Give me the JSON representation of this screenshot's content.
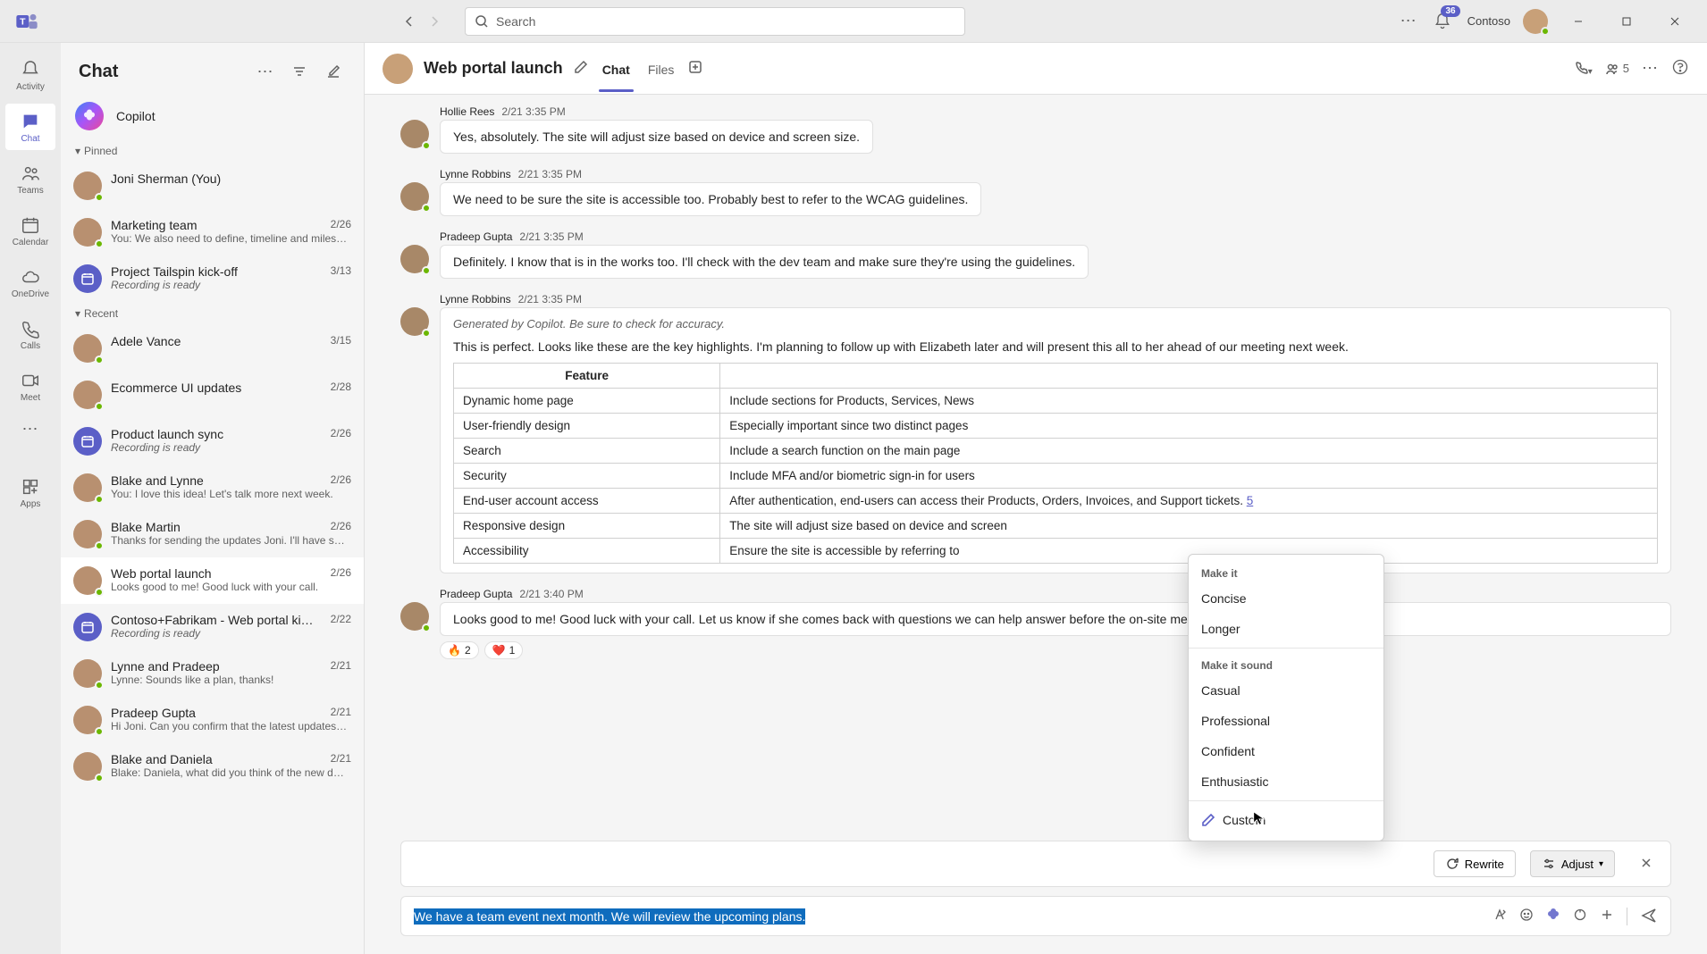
{
  "titlebar": {
    "search_placeholder": "Search",
    "org": "Contoso",
    "notif_count": "36"
  },
  "rail": {
    "items": [
      {
        "id": "activity",
        "label": "Activity"
      },
      {
        "id": "chat",
        "label": "Chat"
      },
      {
        "id": "teams",
        "label": "Teams"
      },
      {
        "id": "calendar",
        "label": "Calendar"
      },
      {
        "id": "onedrive",
        "label": "OneDrive"
      },
      {
        "id": "calls",
        "label": "Calls"
      },
      {
        "id": "meet",
        "label": "Meet"
      }
    ],
    "apps_label": "Apps"
  },
  "chatlist": {
    "title": "Chat",
    "copilot_label": "Copilot",
    "pinned_label": "Pinned",
    "recent_label": "Recent",
    "pinned": [
      {
        "name": "Joni Sherman (You)",
        "date": "",
        "preview": ""
      },
      {
        "name": "Marketing team",
        "date": "2/26",
        "preview": "You: We also need to define, timeline and miles…"
      },
      {
        "name": "Project Tailspin kick-off",
        "date": "3/13",
        "preview": "Recording is ready",
        "italic": true,
        "meeting": true
      }
    ],
    "recent": [
      {
        "name": "Adele Vance",
        "date": "3/15",
        "preview": ""
      },
      {
        "name": "Ecommerce UI updates",
        "date": "2/28",
        "preview": ""
      },
      {
        "name": "Product launch sync",
        "date": "2/26",
        "preview": "Recording is ready",
        "italic": true,
        "meeting": true
      },
      {
        "name": "Blake and Lynne",
        "date": "2/26",
        "preview": "You: I love this idea! Let's talk more next week."
      },
      {
        "name": "Blake Martin",
        "date": "2/26",
        "preview": "Thanks for sending the updates Joni. I'll have s…"
      },
      {
        "name": "Web portal launch",
        "date": "2/26",
        "preview": "Looks good to me! Good luck with your call.",
        "selected": true
      },
      {
        "name": "Contoso+Fabrikam - Web portal ki…",
        "date": "2/22",
        "preview": "Recording is ready",
        "italic": true,
        "meeting": true
      },
      {
        "name": "Lynne and Pradeep",
        "date": "2/21",
        "preview": "Lynne: Sounds like a plan, thanks!"
      },
      {
        "name": "Pradeep Gupta",
        "date": "2/21",
        "preview": "Hi Joni. Can you confirm that the latest updates…"
      },
      {
        "name": "Blake and Daniela",
        "date": "2/21",
        "preview": "Blake: Daniela, what did you think of the new d…"
      }
    ]
  },
  "conv": {
    "title": "Web portal launch",
    "tab_chat": "Chat",
    "tab_files": "Files",
    "people_count": "5",
    "messages": [
      {
        "author": "Hollie Rees",
        "time": "2/21 3:35 PM",
        "text": "Yes, absolutely. The site will adjust size based on device and screen size."
      },
      {
        "author": "Lynne Robbins",
        "time": "2/21 3:35 PM",
        "text": "We need to be sure the site is accessible too. Probably best to refer to the WCAG guidelines."
      },
      {
        "author": "Pradeep Gupta",
        "time": "2/21 3:35 PM",
        "text": "Definitely. I know that is in the works too. I'll check with the dev team and make sure they're using the guidelines."
      }
    ],
    "copilot_msg": {
      "author": "Lynne Robbins",
      "time": "2/21 3:35 PM",
      "gen_note": "Generated by Copilot. Be sure to check for accuracy.",
      "text": "This is perfect. Looks like these are the key highlights. I'm planning to follow up with Elizabeth later and will present this all to her ahead of our meeting next week.",
      "table_header": "Feature",
      "table": [
        {
          "feat": "Dynamic home page",
          "desc": "Include sections for Products, Services, News"
        },
        {
          "feat": "User-friendly design",
          "desc": "Especially important since two distinct pages"
        },
        {
          "feat": "Search",
          "desc": "Include a search function on the main page"
        },
        {
          "feat": "Security",
          "desc": "Include MFA and/or biometric sign-in for users"
        },
        {
          "feat": "End-user account access",
          "desc_a": "After authentication, end-users can access their Products, Orders, Invoices, and Support tickets. ",
          "desc_link": "5"
        },
        {
          "feat": "Responsive design",
          "desc": "The site will adjust size based on device and screen"
        },
        {
          "feat": "Accessibility",
          "desc": "Ensure the site is accessible by referring to"
        }
      ]
    },
    "last_msg": {
      "author": "Pradeep Gupta",
      "time": "2/21 3:40 PM",
      "text": "Looks good to me! Good luck with your call. Let us know if she comes back with questions we can help answer before the on-site meeting.",
      "react_fire": "2",
      "react_heart": "1"
    }
  },
  "copilot_bar": {
    "rewrite": "Rewrite",
    "adjust": "Adjust"
  },
  "adjust_menu": {
    "make_it": "Make it",
    "concise": "Concise",
    "longer": "Longer",
    "sound": "Make it sound",
    "casual": "Casual",
    "professional": "Professional",
    "confident": "Confident",
    "enthusiastic": "Enthusiastic",
    "custom": "Custom"
  },
  "compose": {
    "draft": "We have a team event next month. We will review the upcoming plans."
  }
}
